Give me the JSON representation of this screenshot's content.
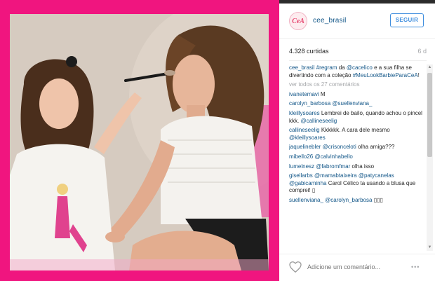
{
  "post": {
    "username": "cee_brasil",
    "avatar_text": "CeA",
    "follow_label": "SEGUIR",
    "likes": "4.328 curtidas",
    "age": "6 d",
    "caption": {
      "user": "cee_brasil",
      "parts": [
        "#regram",
        " da ",
        "@cacelico",
        " e a sua filha se divertindo com a coleção ",
        "#MeuLookBarbieParaCeA",
        "!"
      ]
    },
    "view_all": "ver todos os 27 comentários"
  },
  "comments": [
    {
      "user": "ivanetemavi",
      "text": "M"
    },
    {
      "user": "carolyn_barbosa",
      "text": "",
      "mention": "@suellenviana_"
    },
    {
      "user": "kleillysoares",
      "text": "Lembrei de bailo, quando achou o pincel kkk.",
      "mention": "@callineseelig"
    },
    {
      "user": "callineseelig",
      "text": "Kkkkkk. A cara dele mesmo",
      "mention": "@kleillysoares"
    },
    {
      "user": "jaquelinebler",
      "text": "olha amiga???",
      "mention": "@crisonceloti"
    },
    {
      "user": "mibello26",
      "text": "",
      "mention": "@calvinhabello"
    },
    {
      "user": "lumelnesz",
      "text": "olha isso",
      "mention": "@fabromfmar"
    },
    {
      "user": "gisellarbs",
      "text": "Carol Célico ta usando a blusa que comprei! ▯",
      "mention": "@mamabtaixeira @patycanelas @gabicaminha"
    },
    {
      "user": "suellenviana_",
      "text": "▯▯▯",
      "mention": "@carolyn_barbosa"
    }
  ],
  "add_comment": {
    "placeholder": "Adicione um comentário..."
  },
  "more_label": "•••",
  "colors": {
    "frame": "#f0157f",
    "link": "#125688",
    "follow": "#3f8ede"
  },
  "icons": [
    "heart-icon",
    "chevron-up-icon",
    "chevron-down-icon"
  ]
}
